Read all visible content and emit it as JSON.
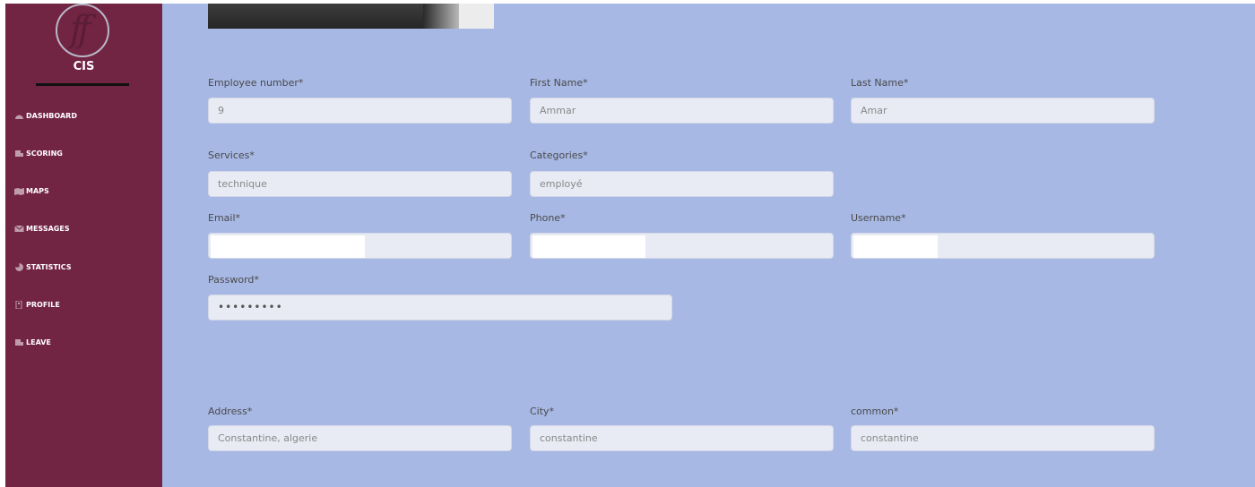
{
  "sidebar": {
    "brand": "CIS",
    "items": [
      {
        "label": "DASHBOARD",
        "icon": "dashboard-icon"
      },
      {
        "label": "SCORING",
        "icon": "scoring-icon"
      },
      {
        "label": "MAPS",
        "icon": "map-icon"
      },
      {
        "label": "MESSAGES",
        "icon": "envelope-icon"
      },
      {
        "label": "STATISTICS",
        "icon": "chart-icon"
      },
      {
        "label": "PROFILE",
        "icon": "profile-icon"
      },
      {
        "label": "LEAVE",
        "icon": "leave-icon"
      }
    ],
    "bg_color": "#722443"
  },
  "main": {
    "bg_color": "#a7b8e4"
  },
  "form": {
    "employee_number": {
      "label": "Employee number*",
      "value": "9"
    },
    "first_name": {
      "label": "First Name*",
      "value": "Ammar"
    },
    "last_name": {
      "label": "Last Name*",
      "value": "Amar"
    },
    "services": {
      "label": "Services*",
      "value": "technique"
    },
    "categories": {
      "label": "Categories*",
      "value": "employé"
    },
    "email": {
      "label": "Email*",
      "value": ""
    },
    "phone": {
      "label": "Phone*",
      "value": ""
    },
    "username": {
      "label": "Username*",
      "value": ""
    },
    "password": {
      "label": "Password*",
      "value": "•••••••••"
    },
    "address": {
      "label": "Address*",
      "value": "Constantine, algerie"
    },
    "city": {
      "label": "City*",
      "value": "constantine"
    },
    "common": {
      "label": "common*",
      "value": "constantine"
    }
  }
}
